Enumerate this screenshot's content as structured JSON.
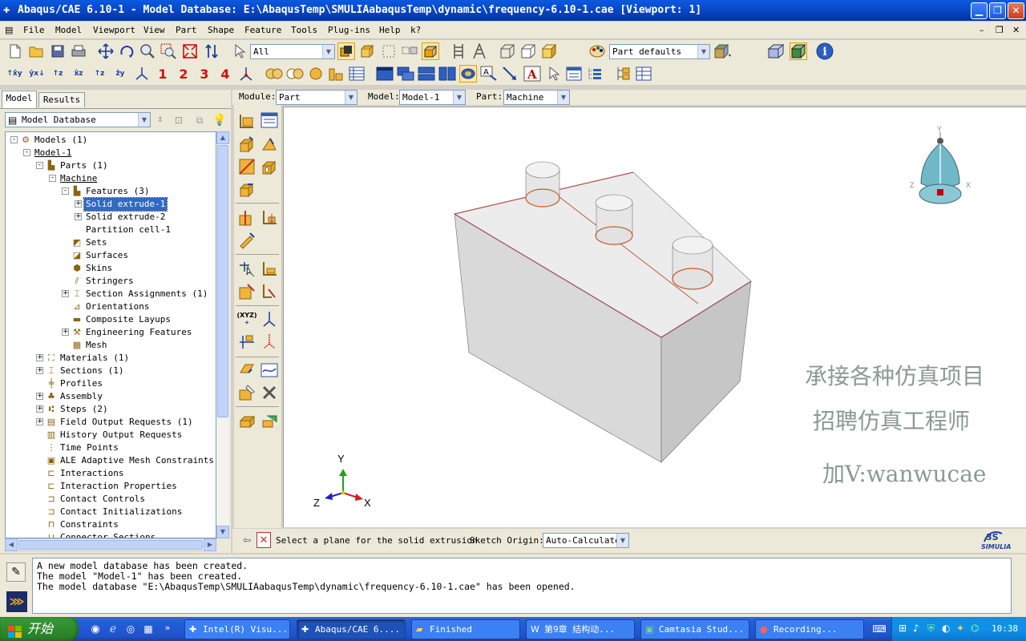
{
  "window": {
    "title": "Abaqus/CAE 6.10-1 - Model Database: E:\\AbaqusTemp\\SMULIAabaqusTemp\\dynamic\\frequency-6.10-1.cae [Viewport: 1]"
  },
  "menu": {
    "items": [
      "File",
      "Model",
      "Viewport",
      "View",
      "Part",
      "Shape",
      "Feature",
      "Tools",
      "Plug-ins",
      "Help",
      "k?"
    ]
  },
  "toolbar": {
    "selection_filter": "All",
    "part_defaults": "Part defaults",
    "datum_numbers": [
      "1",
      "2",
      "3",
      "4"
    ]
  },
  "context": {
    "module_label": "Module:",
    "module_value": "Part",
    "model_label": "Model:",
    "model_value": "Model-1",
    "part_label": "Part:",
    "part_value": "Machine"
  },
  "left_panel": {
    "tabs": [
      "Model",
      "Results"
    ],
    "database_select": "Model Database",
    "tree": [
      {
        "label": "Models (1)",
        "level": 0,
        "exp": "-",
        "icon": "models-icon"
      },
      {
        "label": "Model-1",
        "level": 1,
        "exp": "-",
        "icon": "",
        "underline": true
      },
      {
        "label": "Parts (1)",
        "level": 2,
        "exp": "-",
        "icon": "parts-icon"
      },
      {
        "label": "Machine",
        "level": 3,
        "exp": "-",
        "icon": "",
        "underline": true
      },
      {
        "label": "Features (3)",
        "level": 4,
        "exp": "-",
        "icon": "features-icon"
      },
      {
        "label": "Solid extrude-1",
        "level": 5,
        "exp": "+",
        "icon": "",
        "selected": true
      },
      {
        "label": "Solid extrude-2",
        "level": 5,
        "exp": "+",
        "icon": ""
      },
      {
        "label": "Partition cell-1",
        "level": 5,
        "exp": "",
        "icon": ""
      },
      {
        "label": "Sets",
        "level": 4,
        "exp": "",
        "icon": "sets-icon"
      },
      {
        "label": "Surfaces",
        "level": 4,
        "exp": "",
        "icon": "surfaces-icon"
      },
      {
        "label": "Skins",
        "level": 4,
        "exp": "",
        "icon": "skins-icon"
      },
      {
        "label": "Stringers",
        "level": 4,
        "exp": "",
        "icon": "stringers-icon"
      },
      {
        "label": "Section Assignments (1)",
        "level": 4,
        "exp": "+",
        "icon": "section-assignments-icon"
      },
      {
        "label": "Orientations",
        "level": 4,
        "exp": "",
        "icon": "orientations-icon"
      },
      {
        "label": "Composite Layups",
        "level": 4,
        "exp": "",
        "icon": "composite-layups-icon"
      },
      {
        "label": "Engineering Features",
        "level": 4,
        "exp": "+",
        "icon": "engineering-features-icon"
      },
      {
        "label": "Mesh",
        "level": 4,
        "exp": "",
        "icon": "mesh-icon"
      },
      {
        "label": "Materials (1)",
        "level": 2,
        "exp": "+",
        "icon": "materials-icon"
      },
      {
        "label": "Sections (1)",
        "level": 2,
        "exp": "+",
        "icon": "sections-icon"
      },
      {
        "label": "Profiles",
        "level": 2,
        "exp": "",
        "icon": "profiles-icon"
      },
      {
        "label": "Assembly",
        "level": 2,
        "exp": "+",
        "icon": "assembly-icon"
      },
      {
        "label": "Steps (2)",
        "level": 2,
        "exp": "+",
        "icon": "steps-icon"
      },
      {
        "label": "Field Output Requests (1)",
        "level": 2,
        "exp": "+",
        "icon": "field-output-icon"
      },
      {
        "label": "History Output Requests",
        "level": 2,
        "exp": "",
        "icon": "history-output-icon"
      },
      {
        "label": "Time Points",
        "level": 2,
        "exp": "",
        "icon": "time-points-icon"
      },
      {
        "label": "ALE Adaptive Mesh Constraints",
        "level": 2,
        "exp": "",
        "icon": "ale-icon"
      },
      {
        "label": "Interactions",
        "level": 2,
        "exp": "",
        "icon": "interactions-icon"
      },
      {
        "label": "Interaction Properties",
        "level": 2,
        "exp": "",
        "icon": "interaction-properties-icon"
      },
      {
        "label": "Contact Controls",
        "level": 2,
        "exp": "",
        "icon": "contact-controls-icon"
      },
      {
        "label": "Contact Initializations",
        "level": 2,
        "exp": "",
        "icon": "contact-initializations-icon"
      },
      {
        "label": "Constraints",
        "level": 2,
        "exp": "",
        "icon": "constraints-icon"
      },
      {
        "label": "Connector Sections",
        "level": 2,
        "exp": "",
        "icon": "connector-sections-icon"
      }
    ]
  },
  "viewport": {
    "triad": {
      "x": "X",
      "y": "Y",
      "z": "Z"
    },
    "view_cube": {
      "x": "X",
      "y": "Y",
      "z": "Z"
    },
    "watermark": [
      "承接各种仿真项目",
      "招聘仿真工程师",
      "加V:wanwucae"
    ],
    "brand": "SIMULIA"
  },
  "prompt": {
    "text": "Select a plane for the solid extrusion",
    "origin_label": "Sketch Origin:",
    "origin_value": "Auto-Calculate"
  },
  "messages": [
    "A new model database has been created.",
    "The model \"Model-1\" has been created.",
    "The model database \"E:\\AbaqusTemp\\SMULIAabaqusTemp\\dynamic\\frequency-6.10-1.cae\" has been opened."
  ],
  "taskbar": {
    "start": "开始",
    "tasks": [
      "Intel(R) Visu...",
      "Abaqus/CAE 6....",
      "Finished",
      "第9章 结构动...",
      "Camtasia Stud...",
      "Recording..."
    ],
    "clock": "10:38"
  }
}
